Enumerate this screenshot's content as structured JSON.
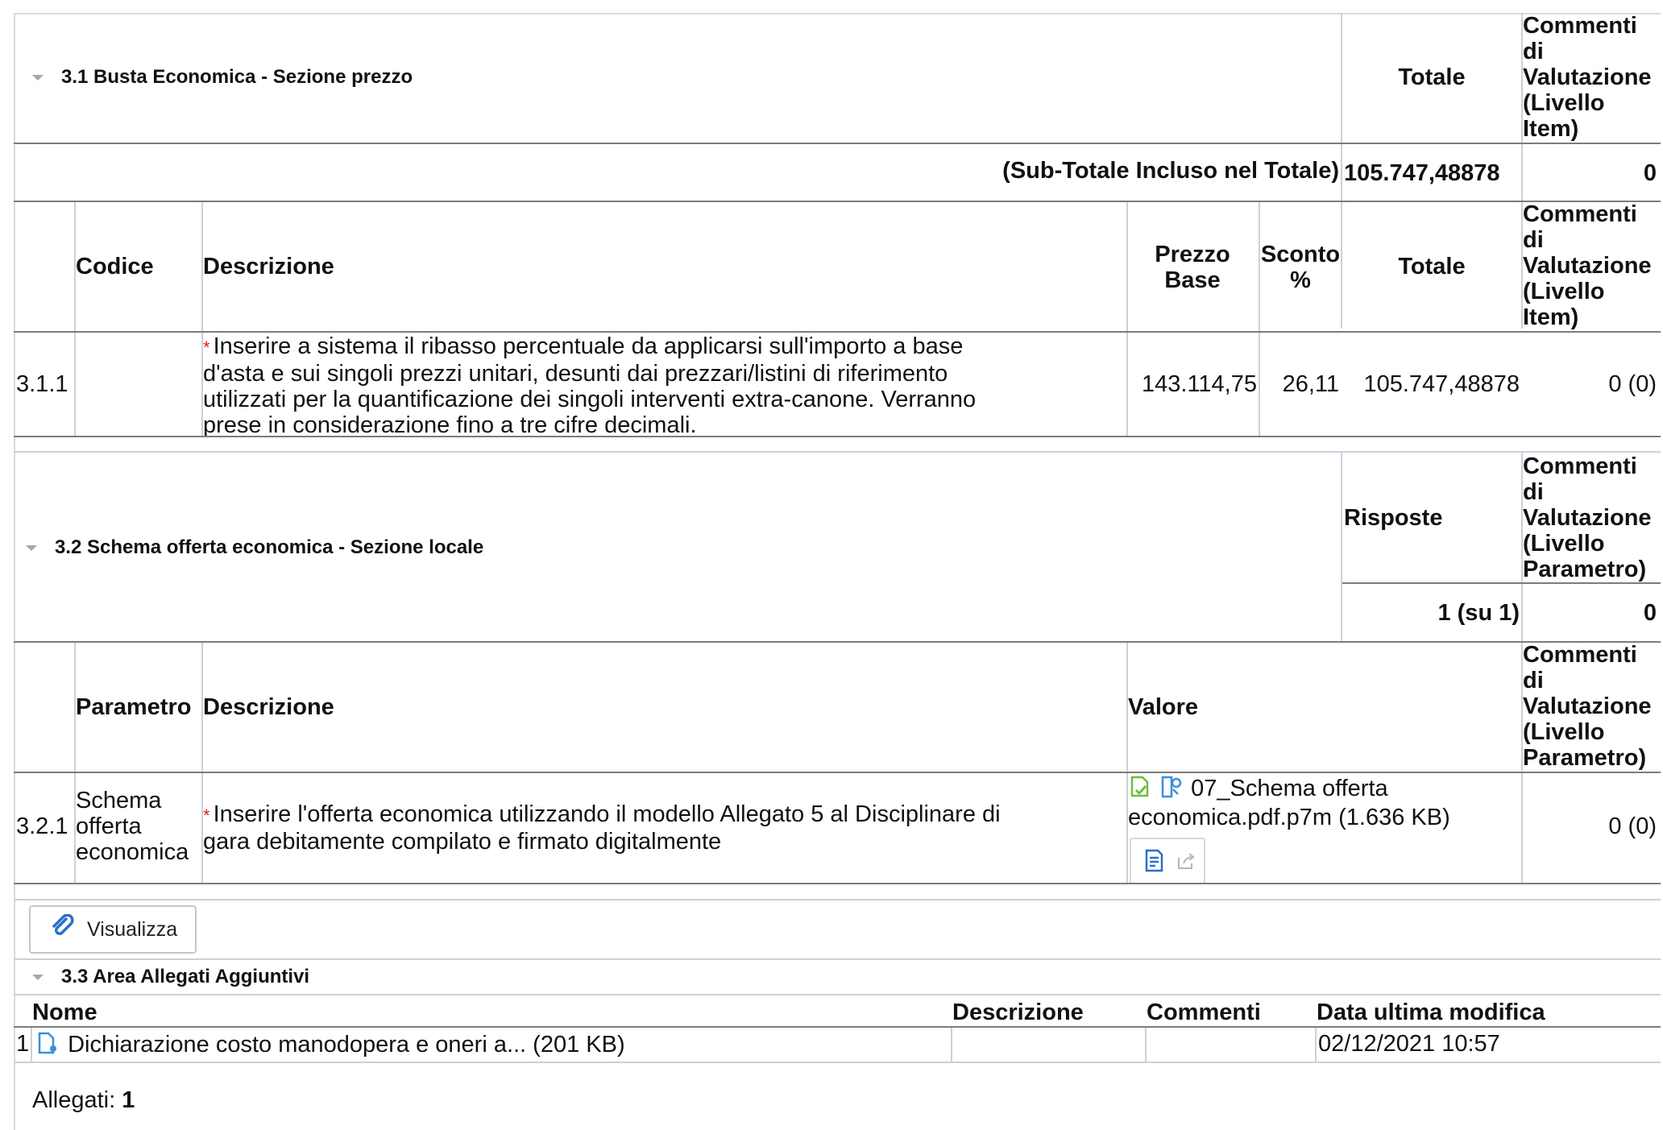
{
  "section31": {
    "title": "3.1  Busta Economica - Sezione prezzo",
    "totale_header": "Totale",
    "comments_header": [
      "Commenti",
      "di",
      "Valutazione",
      "(Livello",
      "Item)"
    ],
    "subtotal_label": "(Sub-Totale Incluso nel Totale)",
    "subtotal_value": "105.747,48878",
    "subtotal_comments": "0",
    "columns": {
      "codice": "Codice",
      "descrizione": "Descrizione",
      "prezzo_base": [
        "Prezzo",
        "Base"
      ],
      "sconto": [
        "Sconto",
        "%"
      ],
      "totale": "Totale",
      "comments": [
        "Commenti",
        "di",
        "Valutazione",
        "(Livello",
        "Item)"
      ]
    },
    "row": {
      "codice": "3.1.1",
      "required_mark": "*",
      "descrizione": [
        "Inserire a sistema il ribasso percentuale da applicarsi sull'importo a base",
        "d'asta e sui singoli prezzi unitari, desunti dai prezzari/listini di riferimento",
        "utilizzati per la quantificazione dei singoli interventi extra-canone. Verranno",
        "prese in considerazione fino a tre cifre decimali."
      ],
      "prezzo_base": "143.114,75",
      "sconto": "26,11",
      "totale": "105.747,48878",
      "comments": "0 (0)"
    }
  },
  "section32": {
    "title": "3.2  Schema offerta economica - Sezione locale",
    "risposte_header": "Risposte",
    "comments_header": [
      "Commenti",
      "di",
      "Valutazione",
      "(Livello",
      "Parametro)"
    ],
    "risposte_value": "1 (su 1)",
    "comments_value": "0",
    "columns": {
      "parametro": "Parametro",
      "descrizione": "Descrizione",
      "valore": "Valore",
      "comments": [
        "Commenti",
        "di",
        "Valutazione",
        "(Livello",
        "Parametro)"
      ]
    },
    "row": {
      "codice": "3.2.1",
      "parametro": [
        "Schema",
        "offerta",
        "economica"
      ],
      "required_mark": "*",
      "descrizione": [
        "Inserire l'offerta economica utilizzando il modello Allegato 5 al Disciplinare di",
        "gara debitamente compilato e firmato digitalmente"
      ],
      "file_line1": "07_Schema offerta",
      "file_line2": "economica.pdf.p7m  (1.636 KB)",
      "comments": "0 (0)"
    }
  },
  "visualizza_button": "Visualizza",
  "section33": {
    "title": "3.3 Area Allegati Aggiuntivi",
    "columns": {
      "nome": "Nome",
      "descrizione": "Descrizione",
      "commenti": "Commenti",
      "data": "Data ultima modifica"
    },
    "row": {
      "index": "1",
      "nome": "Dichiarazione costo manodopera e oneri a...  (201 KB)",
      "data": "02/12/2021 10:57"
    },
    "allegati_label": "Allegati: ",
    "allegati_count": "1"
  }
}
